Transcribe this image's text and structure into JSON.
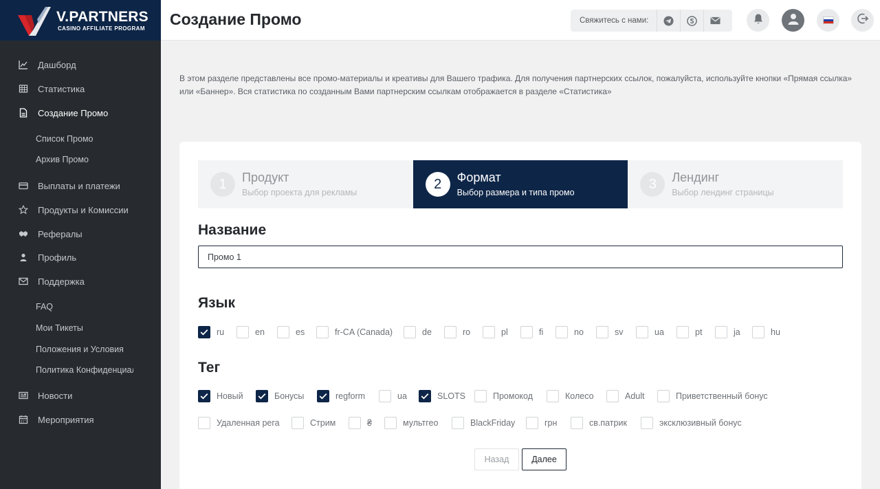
{
  "brand": {
    "name": "V.PARTNERS",
    "tagline": "CASINO AFFILIATE PROGRAM"
  },
  "sidebar": {
    "items": [
      {
        "label": "Дашборд",
        "icon": "chart-line-icon"
      },
      {
        "label": "Статистика",
        "icon": "grid-table-icon"
      },
      {
        "label": "Создание Промо",
        "icon": "document-icon",
        "active": true
      },
      {
        "label": "Список Промо",
        "sub": true
      },
      {
        "label": "Архив Промо",
        "sub": true
      },
      {
        "label": "Выплаты и платежи",
        "icon": "credit-card-icon"
      },
      {
        "label": "Продукты и Комиссии",
        "icon": "star-icon"
      },
      {
        "label": "Рефералы",
        "icon": "handshake-icon"
      },
      {
        "label": "Профиль",
        "icon": "user-icon"
      },
      {
        "label": "Поддержка",
        "icon": "envelope-icon"
      },
      {
        "label": "FAQ",
        "sub": true
      },
      {
        "label": "Мои Тикеты",
        "sub": true
      },
      {
        "label": "Положения и Условия",
        "sub": true
      },
      {
        "label": "Политика Конфиденциальности",
        "sub": true
      },
      {
        "label": "Новости",
        "icon": "newspaper-icon"
      },
      {
        "label": "Мероприятия",
        "icon": "calendar-icon"
      }
    ]
  },
  "header": {
    "title": "Создание Промо",
    "contact_label": "Свяжитесь с нами:",
    "contact_icons": [
      "telegram-icon",
      "skype-icon",
      "mail-icon"
    ],
    "right_icons": [
      "bell-icon",
      "avatar-icon",
      "russian-flag-icon",
      "logout-icon"
    ]
  },
  "intro": {
    "text": "В этом разделе представлены все промо-материалы и креативы для Вашего трафика. Для получения партнерских ссылок, пожалуйста, используйте кнопки «Прямая ссылка» или «Баннер». Вся статистика по созданным Вами партнерским ссылкам отображается в разделе «Статистика»"
  },
  "steps": [
    {
      "num": "1",
      "title": "Продукт",
      "sub": "Выбор проекта для рекламы",
      "active": false
    },
    {
      "num": "2",
      "title": "Формат",
      "sub": "Выбор размера и типа промо",
      "active": true
    },
    {
      "num": "3",
      "title": "Лендинг",
      "sub": "Выбор лендинг страницы",
      "active": false
    }
  ],
  "form": {
    "name_title": "Название",
    "name_value": "Промо 1",
    "lang_title": "Язык",
    "languages": [
      {
        "label": "ru",
        "checked": true
      },
      {
        "label": "en",
        "checked": false
      },
      {
        "label": "es",
        "checked": false
      },
      {
        "label": "fr-CA (Canada)",
        "checked": false
      },
      {
        "label": "de",
        "checked": false
      },
      {
        "label": "ro",
        "checked": false
      },
      {
        "label": "pl",
        "checked": false
      },
      {
        "label": "fi",
        "checked": false
      },
      {
        "label": "no",
        "checked": false
      },
      {
        "label": "sv",
        "checked": false
      },
      {
        "label": "ua",
        "checked": false
      },
      {
        "label": "pt",
        "checked": false
      },
      {
        "label": "ja",
        "checked": false
      },
      {
        "label": "hu",
        "checked": false
      }
    ],
    "tag_title": "Тег",
    "tags_row1": [
      {
        "label": "Новый",
        "checked": true
      },
      {
        "label": "Бонусы",
        "checked": true
      },
      {
        "label": "regform",
        "checked": true
      },
      {
        "label": "ua",
        "checked": false
      },
      {
        "label": "SLOTS",
        "checked": true
      },
      {
        "label": "Промокод",
        "checked": false
      },
      {
        "label": "Колесо",
        "checked": false
      },
      {
        "label": "Adult",
        "checked": false
      },
      {
        "label": "Приветственный бонус",
        "checked": false
      }
    ],
    "tags_row2": [
      {
        "label": "Удаленная рега",
        "checked": false
      },
      {
        "label": "Стрим",
        "checked": false
      },
      {
        "label": "₴",
        "checked": false
      },
      {
        "label": "мультгео",
        "checked": false
      },
      {
        "label": "BlackFriday",
        "checked": false
      },
      {
        "label": "грн",
        "checked": false
      },
      {
        "label": "св.патрик",
        "checked": false
      },
      {
        "label": "эксклюзивный бонус",
        "checked": false
      }
    ],
    "back_label": "Назад",
    "next_label": "Далее"
  }
}
